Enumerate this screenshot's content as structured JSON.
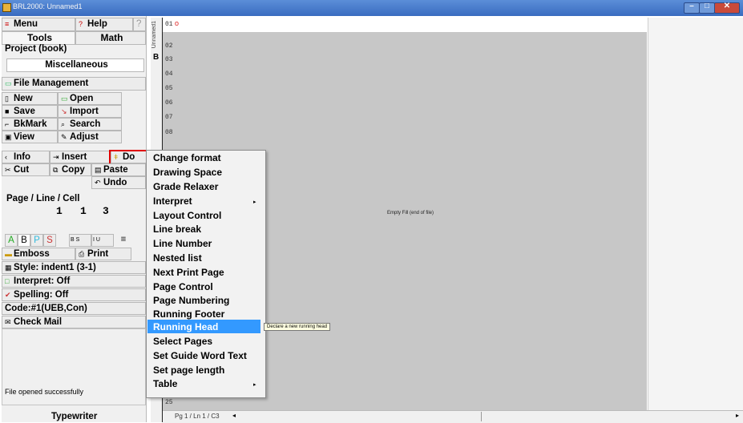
{
  "window": {
    "title": "BRL2000: Unnamed1",
    "min_glyph": "–",
    "max_glyph": "□",
    "close_glyph": "✕"
  },
  "panel": {
    "menu_label": "Menu",
    "help_label": "Help",
    "help_q": "?",
    "tab_tools": "Tools",
    "tab_math": "Math",
    "project_label": "Project (book)",
    "project_value": "Miscellaneous",
    "file_mgmt": "File Management",
    "new": "New",
    "open": "Open",
    "save": "Save",
    "import": "Import",
    "bkmark": "BkMark",
    "search": "Search",
    "view": "View",
    "adjust": "Adjust",
    "info": "Info",
    "insert": "Insert",
    "do": "Do",
    "cut": "Cut",
    "copy": "Copy",
    "paste": "Paste",
    "undo": "Undo",
    "plc_label": "Page / Line / Cell",
    "plc_page": "1",
    "plc_line": "1",
    "plc_cell": "3",
    "fmt_a": "A",
    "fmt_b": "B",
    "fmt_p": "P",
    "fmt_s": "S",
    "fmt_bs": "B S",
    "fmt_iu": "I U",
    "fmt_lines": "≡",
    "emboss": "Emboss",
    "print": "Print",
    "style": "Style: indent1 (3-1)",
    "interpret": "Interpret: Off",
    "spelling": "Spelling: Off",
    "code": "Code:#1(UEB,Con)",
    "check_mail": "Check Mail",
    "status_msg": "File opened successfully",
    "mode": "Typewriter"
  },
  "ruler": {
    "label": "Unnamed1",
    "b": "B"
  },
  "doc": {
    "line_numbers": [
      "01",
      "02",
      "03",
      "04",
      "05",
      "06",
      "07",
      "08"
    ],
    "last_line": "25",
    "marker": "o",
    "empty_fill": "Empty Fill (end of file)"
  },
  "statusbar": {
    "position": "Pg 1 / Ln 1 / C3",
    "caret": "◂"
  },
  "menu": {
    "items": [
      "Change format",
      "Drawing Space",
      "Grade Relaxer",
      "Interpret",
      "Layout Control",
      "Line break",
      "Line Number",
      "Nested list",
      "Next Print Page",
      "Page Control",
      "Page Numbering",
      "Running Footer",
      "Running Head",
      "Select Pages",
      "Set Guide Word Text",
      "Set page length",
      "Table"
    ],
    "highlighted": "Running Head",
    "submenu_arrow": "▸"
  },
  "tooltip": "Declare a new running head",
  "colors": {
    "highlight": "#3399ff",
    "callout": "#e00000",
    "titlebar": "#3a6cc0"
  }
}
